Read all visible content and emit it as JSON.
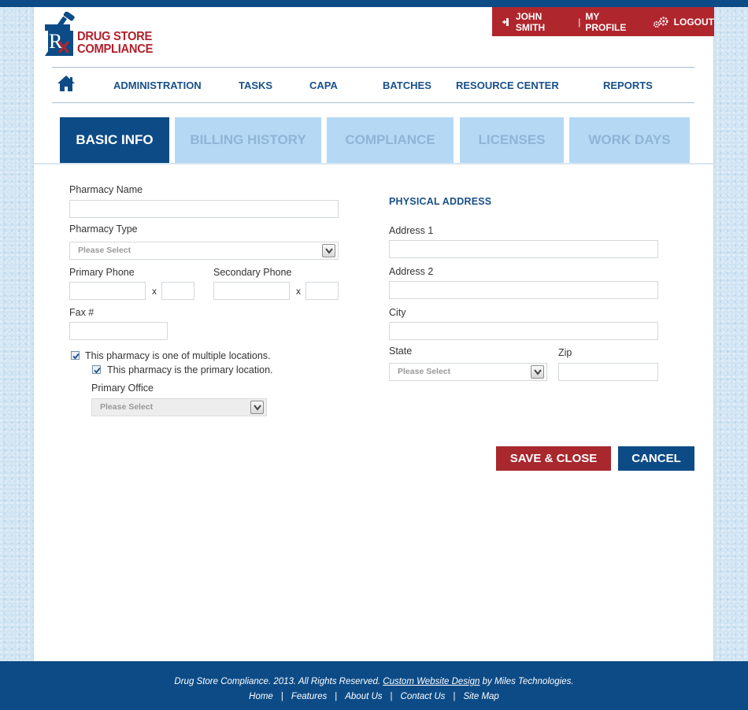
{
  "brand": {
    "logo_letter": "R",
    "line1": "DRUG STORE",
    "line2": "COMPLIANCE",
    "colors": {
      "primary_blue": "#0d4b86",
      "brand_red": "#b0262d",
      "tab_inactive": "#b5d8f5"
    }
  },
  "userbar": {
    "username": "JOHN SMITH",
    "separator": "|",
    "profile": "MY PROFILE",
    "logout": "LOGOUT"
  },
  "nav": {
    "items": [
      "ADMINISTRATION",
      "TASKS",
      "CAPA",
      "BATCHES",
      "RESOURCE CENTER",
      "REPORTS"
    ]
  },
  "tabs": [
    "BASIC INFO",
    "BILLING HISTORY",
    "COMPLIANCE",
    "LICENSES",
    "WORK DAYS"
  ],
  "active_tab": "BASIC INFO",
  "form": {
    "pharmacy_name": {
      "label": "Pharmacy Name",
      "value": ""
    },
    "pharmacy_type": {
      "label": "Pharmacy Type",
      "selected": "Please Select"
    },
    "primary_phone": {
      "label": "Primary Phone",
      "value": "",
      "ext": ""
    },
    "secondary_phone": {
      "label": "Secondary Phone",
      "value": "",
      "ext": ""
    },
    "ext_sep": "x",
    "fax": {
      "label": "Fax #",
      "value": ""
    },
    "multiple_locations": {
      "label": "This pharmacy is one of multiple locations.",
      "checked": true
    },
    "primary_location": {
      "label": "This pharmacy is the primary location.",
      "checked": true
    },
    "primary_office": {
      "label": "Primary Office",
      "selected": "Please Select",
      "disabled": true
    },
    "address_section": "PHYSICAL ADDRESS",
    "address1": {
      "label": "Address 1",
      "value": ""
    },
    "address2": {
      "label": "Address 2",
      "value": ""
    },
    "city": {
      "label": "City",
      "value": ""
    },
    "state": {
      "label": "State",
      "selected": "Please Select"
    },
    "zip": {
      "label": "Zip",
      "value": ""
    }
  },
  "actions": {
    "save": "SAVE & CLOSE",
    "cancel": "CANCEL"
  },
  "footer": {
    "copyright": "Drug Store Compliance. 2013. All Rights Reserved.",
    "design_link": "Custom Website Design",
    "by": "by Miles Technologies.",
    "links": [
      "Home",
      "Features",
      "About Us",
      "Contact Us",
      "Site Map"
    ]
  }
}
